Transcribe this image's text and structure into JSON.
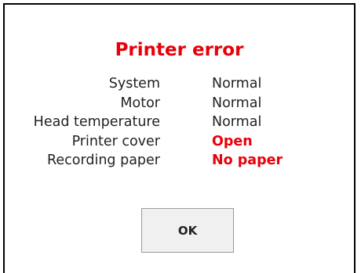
{
  "dialog": {
    "title": "Printer error",
    "status_items": [
      {
        "label": "System",
        "value": "Normal",
        "state": "normal"
      },
      {
        "label": "Motor",
        "value": "Normal",
        "state": "normal"
      },
      {
        "label": "Head temperature",
        "value": "Normal",
        "state": "normal"
      },
      {
        "label": "Printer cover",
        "value": "Open",
        "state": "error"
      },
      {
        "label": "Recording paper",
        "value": "No paper",
        "state": "error"
      }
    ],
    "ok_label": "OK"
  },
  "colors": {
    "error": "#e8000b",
    "text": "#222222",
    "button_bg": "#f0f0f0",
    "border": "#000000"
  }
}
